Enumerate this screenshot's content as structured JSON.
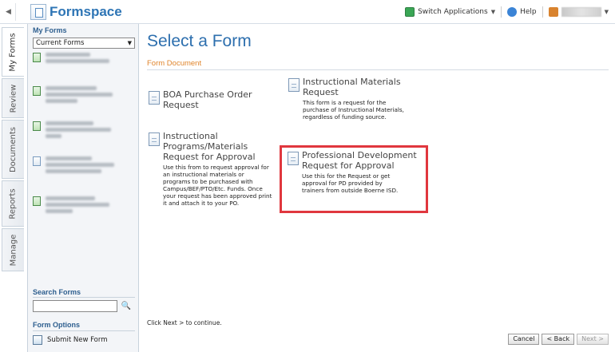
{
  "app": {
    "name": "Formspace",
    "switch_apps_label": "Switch Applications",
    "help_label": "Help"
  },
  "tabs": [
    "My Forms",
    "Review",
    "Documents",
    "Reports",
    "Manage"
  ],
  "sidebar": {
    "title": "My Forms",
    "filter_value": "Current Forms",
    "search_title": "Search Forms",
    "options_title": "Form Options",
    "submit_new_label": "Submit New Form"
  },
  "main": {
    "page_title": "Select a Form",
    "section_label": "Form Document",
    "forms": [
      {
        "title_lines": [
          "BOA Purchase Order",
          "Request"
        ],
        "description": ""
      },
      {
        "title_lines": [
          "Instructional Materials",
          "Request"
        ],
        "description": "This form is a request for the purchase of Instructional Materials, regardless of funding source."
      },
      {
        "title_lines": [
          "Instructional",
          "Programs/Materials",
          "Request for Approval"
        ],
        "description": "Use this from to request approval for an instructional materials or programs to be purchased with Campus/BEF/PTO/Etc. Funds. Once your request has been approved print it and attach it to your PO."
      },
      {
        "title_lines": [
          "Professional Development",
          "Request for Approval"
        ],
        "description": "Use this for the Request or get approval for PD provided by trainers from outside Boerne ISD."
      }
    ],
    "hint": "Click Next > to continue.",
    "buttons": {
      "cancel": "Cancel",
      "back": "< Back",
      "next": "Next >"
    }
  }
}
